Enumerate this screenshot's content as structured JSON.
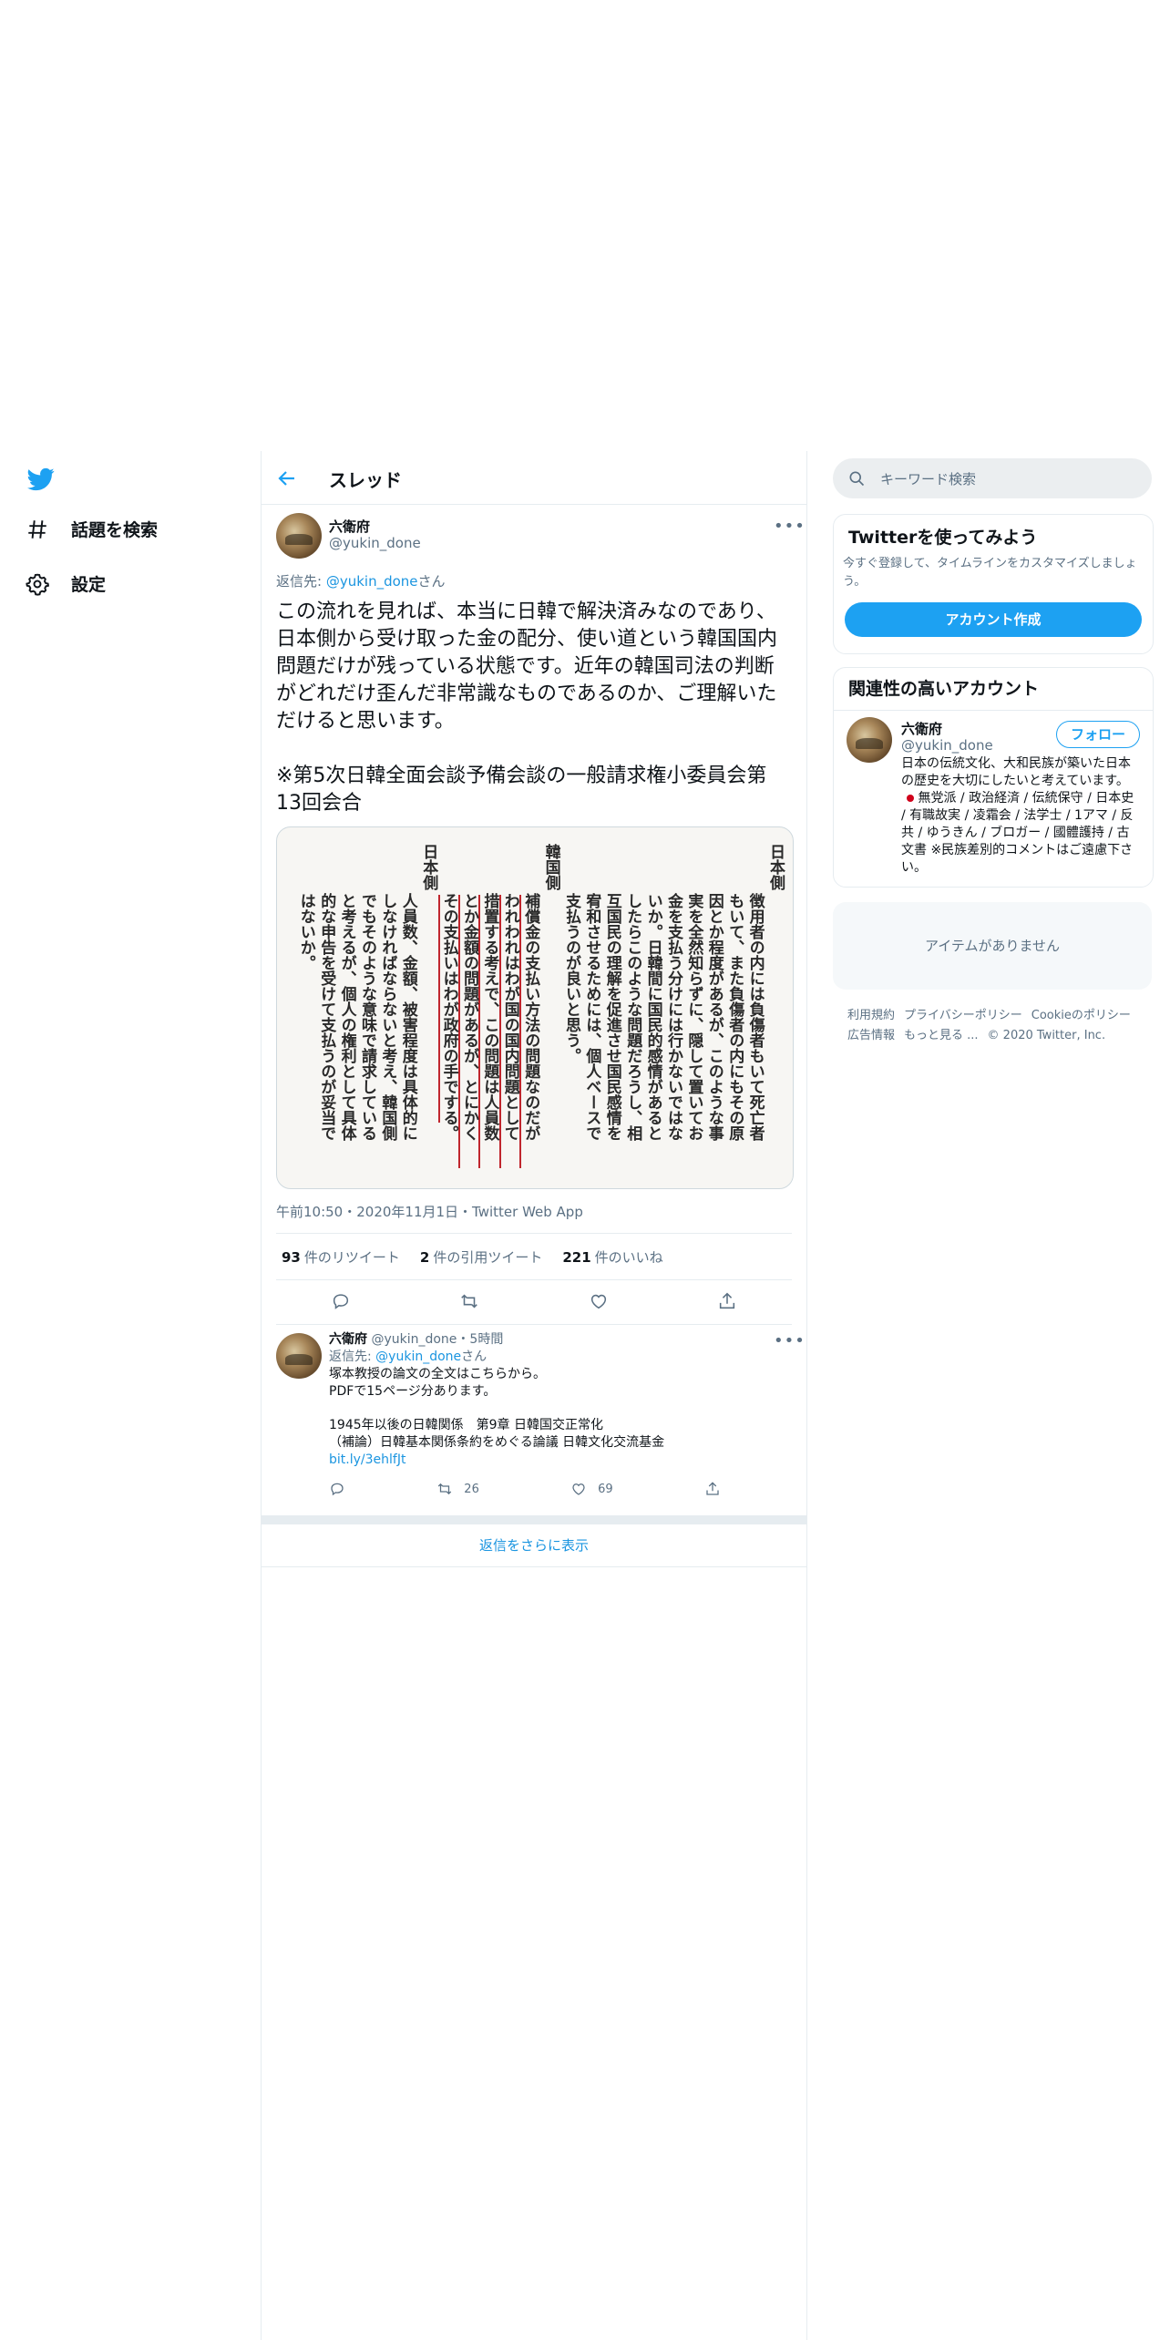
{
  "nav": {
    "explore_label": "話題を検索",
    "settings_label": "設定"
  },
  "header": {
    "title": "スレッド"
  },
  "tweet": {
    "name": "六衛府",
    "handle": "@yukin_done",
    "reply_to_prefix": "返信先: ",
    "reply_to_handle": "@yukin_done",
    "reply_to_suffix": "さん",
    "text": "この流れを見れば、本当に日韓で解決済みなのであり、日本側から受け取った金の配分、使い道という韓国国内問題だけが残っている状態です。近年の韓国司法の判断がどれだけ歪んだ非常識なものであるのか、ご理解いただけると思います。\n\n※第5次日韓全面会談予備会談の一般請求権小委員会第13回会合",
    "image_columns": [
      "日本側",
      "徴用者の内には負傷者もいて死亡者",
      "もいて、また負傷者の内にもその原",
      "因とか程度があるが、このような事",
      "実を全然知らずに、隠して置いてお",
      "金を支払う分けには行かないではな",
      "いか。日韓間に国民的感情があると",
      "したらこのような問題だろうし、相",
      "互国民の理解を促進させ国民感情を",
      "宥和させるためには、個人ベースで",
      "支払うのが良いと思う。",
      "韓国側",
      "補償金の支払い方法の問題なのだが",
      "われわれはわが国の国内問題として",
      "措置する考えで、この問題は人員数",
      "とか金額の問題があるが、とにかく",
      "その支払いはわが政府の手でする。",
      "日本側",
      "人員数、金額、被害程度は具体的に",
      "しなければならないと考え、韓国側",
      "でもそのような意味で請求している",
      "と考えるが、個人の権利として具体",
      "的な申告を受けて支払うのが妥当で",
      "はないか。"
    ],
    "timestamp": "午前10:50・2020年11月1日・Twitter Web App",
    "retweets": "93",
    "retweets_label": "件のリツイート",
    "quotes": "2",
    "quotes_label": "件の引用ツイート",
    "likes": "221",
    "likes_label": "件のいいね"
  },
  "reply": {
    "name": "六衛府",
    "handle_time": "@yukin_done・5時間",
    "reply_to_prefix": "返信先: ",
    "reply_to_handle": "@yukin_done",
    "reply_to_suffix": "さん",
    "line1": "塚本教授の論文の全文はこちらから。",
    "line2": "PDFで15ページ分あります。",
    "line3": "1945年以後の日韓関係　第9章 日韓国交正常化",
    "line4": "（補論）日韓基本関係条約をめぐる論議 日韓文化交流基金",
    "link": "bit.ly/3ehlfJt",
    "retweets": "26",
    "likes": "69"
  },
  "show_more": "返信をさらに表示",
  "sidebar": {
    "search_placeholder": "キーワード検索",
    "signup_title": "Twitterを使ってみよう",
    "signup_desc": "今すぐ登録して、タイムラインをカスタマイズしましょう。",
    "signup_button": "アカウント作成",
    "related_title": "関連性の高いアカウント",
    "related_name": "六衛府",
    "related_handle": "@yukin_done",
    "follow_button": "フォロー",
    "bio_before": "日本の伝統文化、大和民族が築いた日本の歴史を大切にしたいと考えています。",
    "bio_after": " 無党派 / 政治経済 / 伝統保守 / 日本史 / 有職故実 / 凌霜会 / 法学士 / 1アマ / 反共 / ゆうきん / ブロガー / 國體護持 / 古文書 ※民族差別的コメントはご遠慮下さい。",
    "empty_text": "アイテムがありません",
    "footer_links": [
      "利用規約",
      "プライバシーポリシー",
      "Cookieのポリシー",
      "広告情報",
      "もっと見る ..."
    ],
    "copyright": "© 2020 Twitter, Inc."
  },
  "colors": {
    "accent": "#1da1f2",
    "link": "#1b95e0",
    "secondary": "#5b7083",
    "border": "#e6ecf0"
  }
}
